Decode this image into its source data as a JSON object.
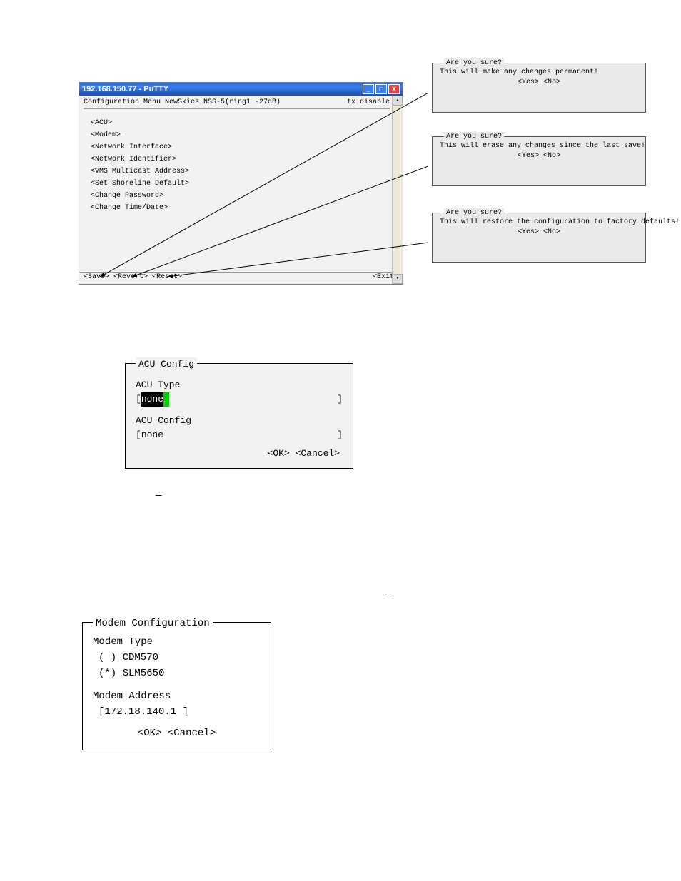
{
  "putty": {
    "title": "192.168.150.77 - PuTTY",
    "header_left": "Configuration Menu  NewSkies NSS-5(ring1 -27dB)",
    "header_right": "tx disable",
    "menu": {
      "acu": "<ACU>",
      "modem": "<Modem>",
      "network_interface": "<Network Interface>",
      "network_identifier": "<Network Identifier>",
      "vms_multicast": "<VMS Multicast Address>",
      "set_shoreline": "<Set Shoreline Default>",
      "change_password": "<Change Password>",
      "change_time_date": "<Change Time/Date>"
    },
    "bottom": {
      "save": "<Save>",
      "revert": "<Revert>",
      "reset": "<Reset>",
      "exit": "<Exit>"
    }
  },
  "dialog_save": {
    "title": " Are you sure?",
    "msg": "This will make any changes permanent!",
    "yesno": "<Yes> <No>"
  },
  "dialog_revert": {
    "title": " Are you sure?",
    "msg": "This will erase any changes since the last save!",
    "yesno": "<Yes> <No>"
  },
  "dialog_reset": {
    "title": " Are you sure?",
    "msg": "This will restore the configuration to factory defaults!",
    "yesno": "<Yes> <No>"
  },
  "acu": {
    "title": " ACU Config",
    "type_label": "ACU Type",
    "type_value": "none",
    "config_label": "ACU Config",
    "config_value": "none",
    "ok": "<OK>",
    "cancel": "<Cancel>"
  },
  "modem": {
    "title": " Modem Configuration",
    "type_label": "Modem Type",
    "opt1": "( ) CDM570",
    "opt2": "(*) SLM5650",
    "addr_label": "Modem Address",
    "addr_value": "[172.18.140.1    ]",
    "ok": "<OK>",
    "cancel": "<Cancel>"
  }
}
